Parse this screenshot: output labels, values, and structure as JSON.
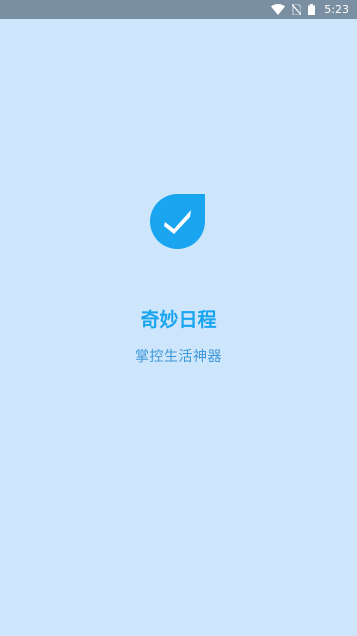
{
  "status_bar": {
    "time": "5:23",
    "icons": [
      "wifi-icon",
      "no-sim-icon",
      "battery-icon"
    ]
  },
  "splash": {
    "logo_icon": "check-drop-icon",
    "app_name": "奇妙日程",
    "slogan": "掌控生活神器",
    "colors": {
      "background": "#cde6fb",
      "status_bar": "#7b8fa3",
      "accent": "#1aa5f0",
      "slogan": "#3d97d8"
    }
  }
}
